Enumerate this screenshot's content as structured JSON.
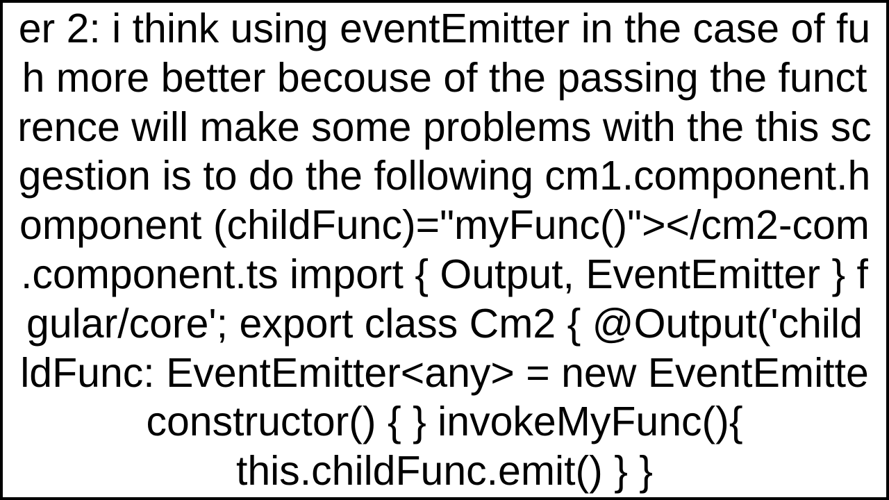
{
  "lines": [
    "er 2: i think using eventEmitter in the case of fu",
    "h more better becouse of the passing the funct",
    "rence will make some problems with the this sc",
    "gestion is to do the following cm1.component.h",
    "omponent (childFunc)=\"myFunc()\"></cm2-com",
    ".component.ts import { Output, EventEmitter } f",
    "gular/core'; export class Cm2 {   @Output('child",
    "ldFunc: EventEmitter<any> = new EventEmitte",
    "constructor() { }   invokeMyFunc(){",
    "this.childFunc.emit()   } }"
  ]
}
